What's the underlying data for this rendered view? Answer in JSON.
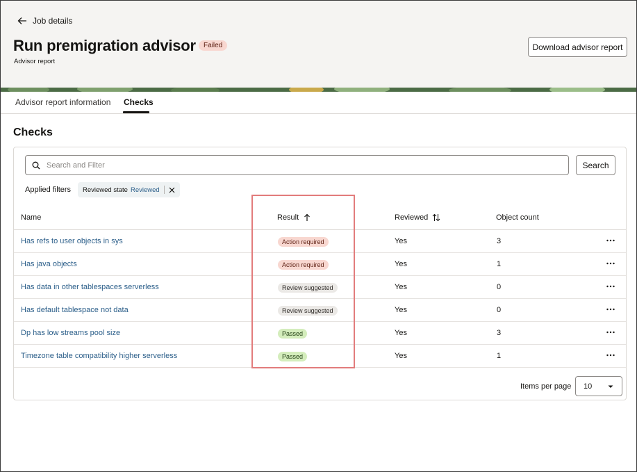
{
  "header": {
    "back_label": "Job details",
    "title": "Run premigration advisor",
    "status": "Failed",
    "subtitle": "Advisor report",
    "download_label": "Download advisor report"
  },
  "tabs": [
    {
      "label": "Advisor report information",
      "active": false
    },
    {
      "label": "Checks",
      "active": true
    }
  ],
  "section_title": "Checks",
  "search": {
    "placeholder": "Search and Filter",
    "value": "",
    "button_label": "Search"
  },
  "filters": {
    "label": "Applied filters",
    "chips": [
      {
        "key": "Reviewed state",
        "value": "Reviewed"
      }
    ]
  },
  "table": {
    "columns": [
      "Name",
      "Result",
      "Reviewed",
      "Object count"
    ],
    "sort": {
      "Result": "ascending",
      "Reviewed": "sortable"
    },
    "rows": [
      {
        "name": "Has refs to user objects in sys",
        "result": "Action required",
        "result_type": "action",
        "reviewed": "Yes",
        "object_count": "3"
      },
      {
        "name": "Has java objects",
        "result": "Action required",
        "result_type": "action",
        "reviewed": "Yes",
        "object_count": "1"
      },
      {
        "name": "Has data in other tablespaces serverless",
        "result": "Review suggested",
        "result_type": "review",
        "reviewed": "Yes",
        "object_count": "0"
      },
      {
        "name": "Has default tablespace not data",
        "result": "Review suggested",
        "result_type": "review",
        "reviewed": "Yes",
        "object_count": "0"
      },
      {
        "name": "Dp has low streams pool size",
        "result": "Passed",
        "result_type": "passed",
        "reviewed": "Yes",
        "object_count": "3"
      },
      {
        "name": "Timezone table compatibility higher serverless",
        "result": "Passed",
        "result_type": "passed",
        "reviewed": "Yes",
        "object_count": "1"
      }
    ]
  },
  "pagination": {
    "items_per_page_label": "Items per page",
    "items_per_page_value": "10"
  },
  "colors": {
    "link": "#2c5f8a",
    "action_badge": "#f8d7d0",
    "review_badge": "#ebe9e6",
    "passed_badge": "#d4edbc",
    "highlight": "#e27c7c"
  }
}
